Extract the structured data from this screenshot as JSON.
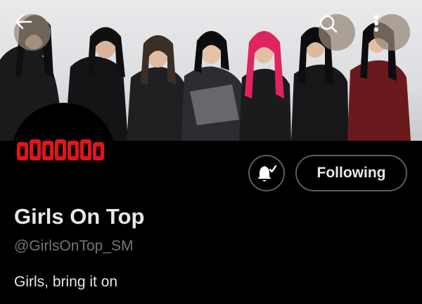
{
  "header": {
    "back_icon": "arrow-left-icon",
    "search_icon": "search-icon",
    "more_icon": "more-vertical-icon"
  },
  "banner": {
    "description_icon": "group-photo-banner"
  },
  "avatar": {
    "icon": "red-logo-avatar"
  },
  "actions": {
    "notification_icon": "bell-check-icon",
    "follow_label": "Following"
  },
  "profile": {
    "name": "Girls On Top",
    "handle": "@GirlsOnTop_SM",
    "bio": "Girls, bring it on"
  },
  "colors": {
    "background": "#000000",
    "text_primary": "#e7e9ea",
    "text_secondary": "#71767b",
    "button_border": "#5b5d61",
    "logo_red": "#e0141e"
  }
}
